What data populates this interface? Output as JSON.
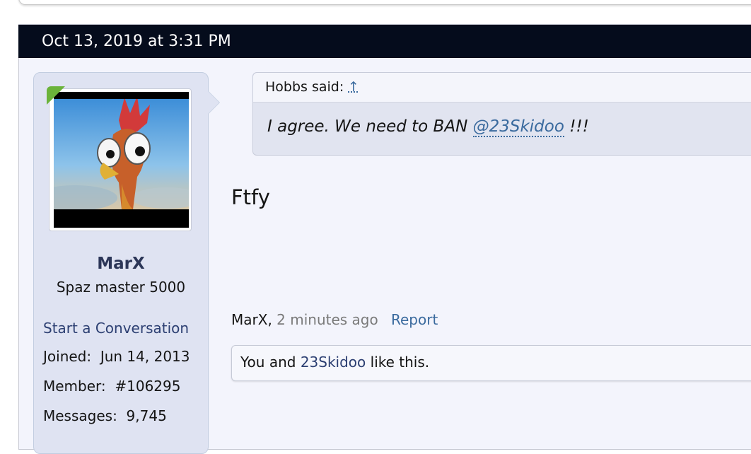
{
  "post": {
    "date": "Oct 13, 2019 at 3:31 PM",
    "message": "Ftfy"
  },
  "user": {
    "name": "MarX",
    "title": "Spaz master 5000",
    "start_conversation": "Start a Conversation",
    "joined_label": "Joined:",
    "joined_value": "Jun 14, 2013",
    "member_label": "Member:",
    "member_value": "#106295",
    "messages_label": "Messages:",
    "messages_value": "9,745",
    "online_color": "#6bb33a"
  },
  "quote": {
    "author": "Hobbs said:",
    "jump_icon": "↑",
    "text_before": "I agree. We need to BAN ",
    "mention": "@23Skidoo",
    "text_after": " !!!"
  },
  "meta": {
    "author": "MarX",
    "separator": ",",
    "time": "2 minutes ago",
    "report": "Report"
  },
  "likes": {
    "you": "You and ",
    "other": "23Skidoo",
    "suffix": " like this."
  },
  "colors": {
    "date_bar": "#050c1c",
    "link": "#3a6a9e",
    "username": "#2c3658"
  }
}
